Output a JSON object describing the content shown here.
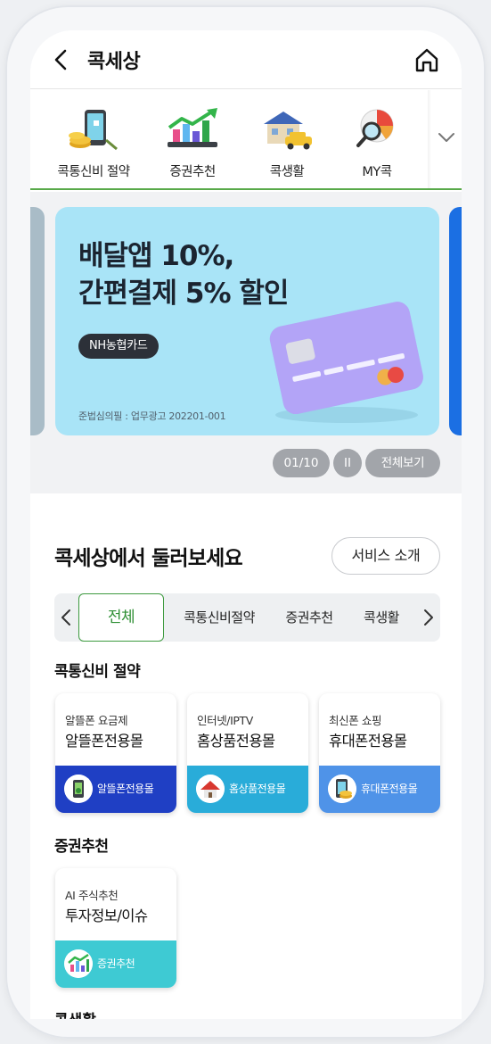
{
  "header": {
    "title": "콕세상"
  },
  "categories": [
    {
      "label": "콕통신비 절약",
      "icon": "phone-coins-icon"
    },
    {
      "label": "증권추천",
      "icon": "stock-chart-icon"
    },
    {
      "label": "콕생활",
      "icon": "house-car-icon"
    },
    {
      "label": "MY콕",
      "icon": "magnifier-pie-icon"
    }
  ],
  "banner": {
    "headline_line1": "배달앱 10%,",
    "headline_line2": "간편결제 5% 할인",
    "chip": "NH농협카드",
    "note": "준법심의필 : 업무광고 202201-001",
    "background": "#a9e4f7"
  },
  "pager": {
    "count": "01/10",
    "pause": "II",
    "view_all": "전체보기"
  },
  "section": {
    "title": "콕세상에서 둘러보세요",
    "intro_button": "서비스 소개"
  },
  "filters": {
    "tabs": [
      "전체",
      "콕통신비절약",
      "증권추천",
      "콕생활"
    ],
    "active": "전체"
  },
  "groups": [
    {
      "title": "콕통신비 절약",
      "cards": [
        {
          "sub": "알뜰폰 요금제",
          "main": "알뜰폰전용몰",
          "foot": "알뜰폰전용몰",
          "color": "#1f3fc4",
          "icon": "phone-sim-icon"
        },
        {
          "sub": "인터넷/IPTV",
          "main": "홈상품전용몰",
          "foot": "홈상품전용몰",
          "color": "#29acd9",
          "icon": "house-icon"
        },
        {
          "sub": "최신폰 쇼핑",
          "main": "휴대폰전용몰",
          "foot": "휴대폰전용몰",
          "color": "#4f93e8",
          "icon": "phone-coins-icon"
        }
      ]
    },
    {
      "title": "증권추천",
      "cards": [
        {
          "sub": "AI 주식추천",
          "main": "투자정보/이슈",
          "foot": "증권추천",
          "color": "#3ecad3",
          "icon": "stock-chart-icon"
        }
      ]
    }
  ],
  "next_group_title": "콕생활",
  "colors": {
    "accent_green": "#3d9a3f",
    "pager_gray": "#a2a5aa"
  }
}
